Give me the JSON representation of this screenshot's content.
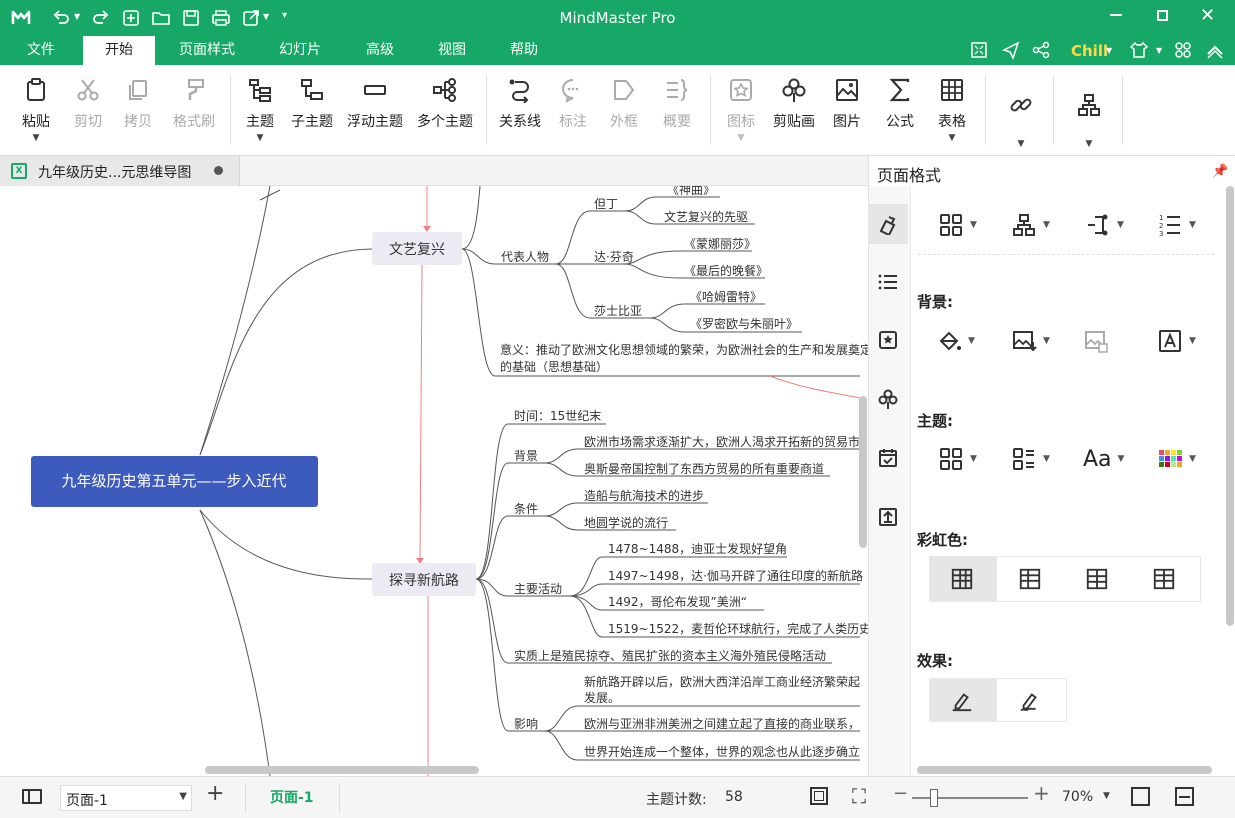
{
  "app": {
    "title": "MindMaster Pro",
    "user": "Chill"
  },
  "menu": {
    "items": [
      "文件",
      "开始",
      "页面样式",
      "幻灯片",
      "高级",
      "视图",
      "帮助"
    ],
    "active": "开始"
  },
  "ribbon": {
    "buttons": [
      {
        "label": "粘贴",
        "icon": "paste-icon",
        "enabled": true
      },
      {
        "label": "剪切",
        "icon": "cut-icon",
        "enabled": false
      },
      {
        "label": "拷贝",
        "icon": "copy-icon",
        "enabled": false
      },
      {
        "label": "格式刷",
        "icon": "format-painter-icon",
        "enabled": false
      },
      {
        "label": "主题",
        "icon": "topic-icon",
        "enabled": true
      },
      {
        "label": "子主题",
        "icon": "subtopic-icon",
        "enabled": true
      },
      {
        "label": "浮动主题",
        "icon": "floating-topic-icon",
        "enabled": true
      },
      {
        "label": "多个主题",
        "icon": "multiple-topics-icon",
        "enabled": true
      },
      {
        "label": "关系线",
        "icon": "relationship-icon",
        "enabled": true
      },
      {
        "label": "标注",
        "icon": "callout-icon",
        "enabled": false
      },
      {
        "label": "外框",
        "icon": "boundary-icon",
        "enabled": false
      },
      {
        "label": "概要",
        "icon": "summary-icon",
        "enabled": false
      },
      {
        "label": "图标",
        "icon": "mark-icon",
        "enabled": false
      },
      {
        "label": "剪贴画",
        "icon": "clipart-icon",
        "enabled": true
      },
      {
        "label": "图片",
        "icon": "picture-icon",
        "enabled": true
      },
      {
        "label": "公式",
        "icon": "formula-icon",
        "enabled": true
      },
      {
        "label": "表格",
        "icon": "table-icon",
        "enabled": true
      }
    ]
  },
  "doc_tab": {
    "title": "九年级历史...元思维导图"
  },
  "map": {
    "central": "九年级历史第五单元——步入近代",
    "topics": {
      "renaissance": "文艺复兴",
      "exploration": "探寻新航路"
    },
    "renaissance": {
      "rep": "代表人物",
      "dante": "但丁",
      "dante_works": [
        "《神曲》",
        "文艺复兴的先驱"
      ],
      "davinci": "达·芬奇",
      "davinci_works": [
        "《蒙娜丽莎》",
        "《最后的晚餐》"
      ],
      "shakespeare": "莎士比亚",
      "shakespeare_works": [
        "《哈姆雷特》",
        "《罗密欧与朱丽叶》"
      ],
      "meaning1": "意义：推动了欧洲文化思想领域的繁荣，为欧洲社会的生产和发展奠定",
      "meaning2": "的基础（思想基础）"
    },
    "exploration": {
      "time": "时间：15世纪末",
      "bg": "背景",
      "bg_items": [
        "欧洲市场需求逐渐扩大，欧洲人渴求开拓新的贸易市",
        "奥斯曼帝国控制了东西方贸易的所有重要商道"
      ],
      "cond": "条件",
      "cond_items": [
        "造船与航海技术的进步",
        "地圆学说的流行"
      ],
      "main": "主要活动",
      "main_items": [
        "1478~1488，迪亚士发现好望角",
        "1497~1498，达·伽马开辟了通往印度的新航路",
        "1492，哥伦布发现”美洲“",
        "1519~1522，麦哲伦环球航行，完成了人类历史"
      ],
      "essence": "实质上是殖民掠夺、殖民扩张的资本主义海外殖民侵略活动",
      "impact": "影响",
      "impact_items": [
        "新航路开辟以后，欧洲大西洋沿岸工商业经济繁荣起",
        "发展。",
        "欧洲与亚洲非洲美洲之间建立起了直接的商业联系，",
        "世界开始连成一个整体，世界的观念也从此逐步确立"
      ]
    }
  },
  "panel": {
    "title": "页面格式",
    "sections": {
      "background": "背景:",
      "topic": "主题:",
      "rainbow": "彩虹色:",
      "effect": "效果:"
    }
  },
  "status": {
    "page_select": "页面-1",
    "page_tab": "页面-1",
    "topic_count_label": "主题计数:",
    "topic_count": "58",
    "zoom": "70%"
  },
  "colors": {
    "brand": "#17a868",
    "central": "#3d5bbd",
    "topic_bg": "#ecebf3",
    "relation": "#f08080"
  }
}
